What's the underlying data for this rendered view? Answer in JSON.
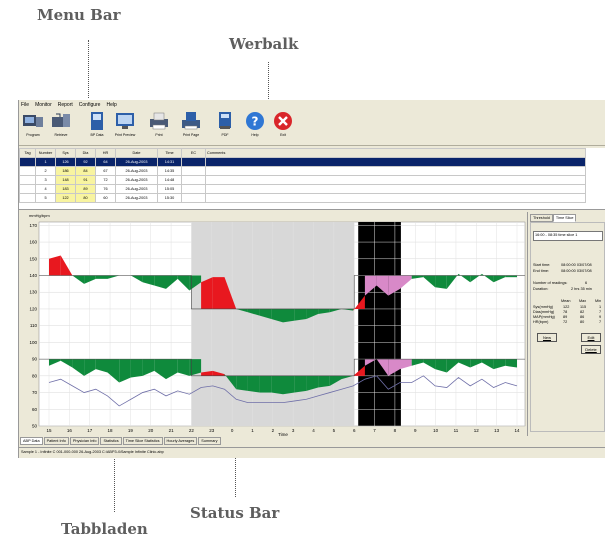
{
  "callouts": {
    "menu_bar": "Menu Bar",
    "werbalk": "Werbalk",
    "tabbladen": "Tabbladen",
    "status_bar": "Status Bar"
  },
  "menu": [
    "File",
    "Monitor",
    "Report",
    "Configure",
    "Help"
  ],
  "toolbar": [
    {
      "label": "Program",
      "icon": "monitor-program-icon"
    },
    {
      "label": "Retrieve",
      "icon": "retrieve-icon"
    },
    {
      "label": "BP Data",
      "icon": "bp-data-icon"
    },
    {
      "label": "Print Preview",
      "icon": "print-preview-icon"
    },
    {
      "label": "Print",
      "icon": "printer-icon"
    },
    {
      "label": "Print Page",
      "icon": "print-page-icon"
    },
    {
      "label": "PDF",
      "icon": "pdf-icon"
    },
    {
      "label": "Help",
      "icon": "help-icon"
    },
    {
      "label": "Exit",
      "icon": "exit-icon"
    }
  ],
  "grid": {
    "headers": [
      "Tag",
      "Number",
      "Sys",
      "Dia",
      "HR",
      "Date",
      "Time",
      "EC",
      "Comments"
    ],
    "rows": [
      [
        "",
        "1",
        "126",
        "92",
        "64",
        "26-Aug-2003",
        "14:31",
        "",
        ""
      ],
      [
        "",
        "2",
        "186",
        "84",
        "67",
        "26-Aug-2003",
        "14:35",
        "",
        ""
      ],
      [
        "",
        "3",
        "148",
        "91",
        "72",
        "26-Aug-2003",
        "14:48",
        "",
        ""
      ],
      [
        "",
        "4",
        "183",
        "89",
        "76",
        "26-Aug-2003",
        "15:05",
        "",
        ""
      ],
      [
        "",
        "5",
        "122",
        "80",
        "60",
        "26-Aug-2003",
        "15:30",
        "",
        ""
      ]
    ]
  },
  "chart_data": {
    "type": "area",
    "title": "mmHg/bpm",
    "xlabel": "Time",
    "x_ticks": [
      "15",
      "16",
      "17",
      "18",
      "19",
      "20",
      "21",
      "22",
      "23",
      "0",
      "1",
      "2",
      "3",
      "4",
      "5",
      "6",
      "7",
      "8",
      "9",
      "10",
      "11",
      "12",
      "13",
      "14"
    ],
    "y_ticks": [
      170,
      160,
      150,
      140,
      130,
      120,
      110,
      100,
      90,
      80,
      70,
      60,
      50
    ],
    "ylim": [
      50,
      172
    ],
    "series": [
      {
        "values": [
          150,
          152,
          140,
          135,
          138,
          138,
          140,
          140,
          136,
          134,
          132,
          138,
          131,
          136,
          139,
          139,
          120,
          118,
          116,
          114,
          112,
          113,
          114,
          117,
          118,
          120,
          119,
          128,
          134,
          128,
          132,
          138,
          139,
          133,
          132,
          141,
          136,
          141,
          136,
          139,
          139
        ]
      },
      {
        "values": [
          86,
          89,
          85,
          80,
          84,
          82,
          76,
          79,
          80,
          83,
          78,
          82,
          80,
          82,
          83,
          81,
          72,
          71,
          70,
          70,
          69,
          70,
          71,
          73,
          74,
          78,
          80,
          86,
          90,
          80,
          84,
          86,
          88,
          84,
          82,
          88,
          85,
          88,
          84,
          86,
          85
        ]
      },
      {
        "values": [
          76,
          78,
          74,
          70,
          72,
          68,
          62,
          66,
          70,
          72,
          68,
          71,
          69,
          73,
          74,
          72,
          66,
          64,
          64,
          64,
          64,
          65,
          66,
          68,
          70,
          72,
          74,
          78,
          80,
          72,
          76,
          76,
          80,
          74,
          73,
          79,
          74,
          78,
          73,
          76,
          74
        ]
      }
    ],
    "thresholds": {
      "sys_day": 140,
      "sys_night": 120,
      "dia_day": 90,
      "dia_night": 80
    },
    "night_period": [
      "22",
      "6"
    ],
    "marked_period": [
      "6",
      "8"
    ],
    "grid": true
  },
  "right_panel": {
    "tabs": [
      "Threshold",
      "Time Slice"
    ],
    "slice_list": "16:00 - 08:35  time slice 1",
    "start_label": "Start time:",
    "start_value": "08:00:00 03/07/08",
    "end_label": "End time:",
    "end_value": "08:00:00 03/07/08",
    "num_label": "Number of readings:",
    "num_value": "6",
    "dur_label": "Duration:",
    "dur_value": "2 hrs 35 min",
    "stats_header": [
      "Mean",
      "Max",
      "Min"
    ],
    "stats": [
      [
        "Sys(mmHg)",
        "122",
        "115",
        "1"
      ],
      [
        "Dias(mmHg)",
        "78",
        "82",
        "7"
      ],
      [
        "MAP(mmHg)",
        "89",
        "86",
        "9"
      ],
      [
        "HR(bpm)",
        "72",
        "80",
        "7"
      ]
    ],
    "buttons": [
      "New",
      "Edit",
      "Delete"
    ]
  },
  "tabs": [
    "ABP Data",
    "Patient Info",
    "Physician Info",
    "Statistics",
    "Time Slice Statistics",
    "Hourly Averages",
    "Summary"
  ],
  "status": "Sample 1 - Infinite C 001-000-000 26-Aug-2003 C:\\ABP3.4\\Sample Infinite Clinic.abp",
  "colors": {
    "grid_selected": "#0a246a",
    "green": "#0f8a3c",
    "red": "#e8181f",
    "pink": "#d889c8",
    "night": "#d8d8d8",
    "marked": "#000000"
  }
}
